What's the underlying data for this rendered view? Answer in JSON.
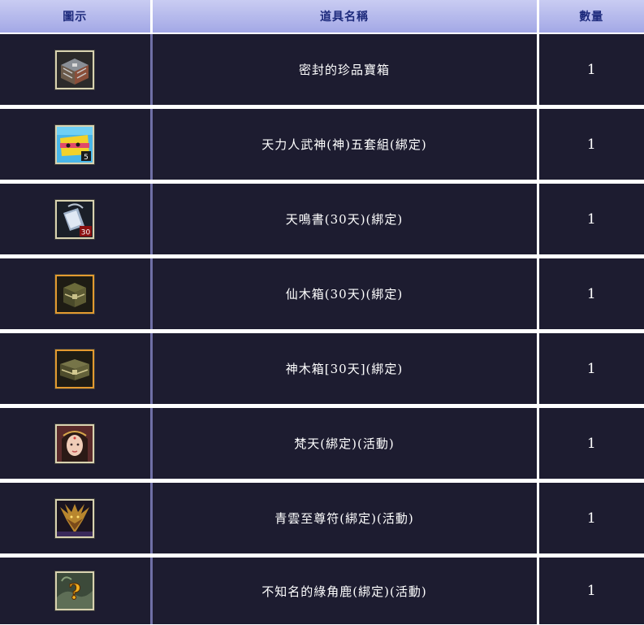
{
  "table": {
    "headers": {
      "icon": "圖示",
      "name": "道具名稱",
      "quantity": "數量"
    },
    "rows": [
      {
        "name": "密封的珍品寶箱",
        "quantity": "1",
        "icon": "sealed-treasure-chest-icon"
      },
      {
        "name": "天力人武神(神)五套組(綁定)",
        "quantity": "1",
        "icon": "gift-box-set-icon",
        "badge": "5"
      },
      {
        "name": "天鳴書(30天)(綁定)",
        "quantity": "1",
        "icon": "skill-book-icon",
        "badge": "30"
      },
      {
        "name": "仙木箱(30天)(綁定)",
        "quantity": "1",
        "icon": "wooden-chest-icon"
      },
      {
        "name": "神木箱[30天](綁定)",
        "quantity": "1",
        "icon": "divine-wooden-chest-icon"
      },
      {
        "name": "梵天(綁定)(活動)",
        "quantity": "1",
        "icon": "female-portrait-icon"
      },
      {
        "name": "青雲至尊符(綁定)(活動)",
        "quantity": "1",
        "icon": "dragon-talisman-icon"
      },
      {
        "name": "不知名的綠角鹿(綁定)(活動)",
        "quantity": "1",
        "icon": "unknown-mount-icon"
      }
    ]
  }
}
